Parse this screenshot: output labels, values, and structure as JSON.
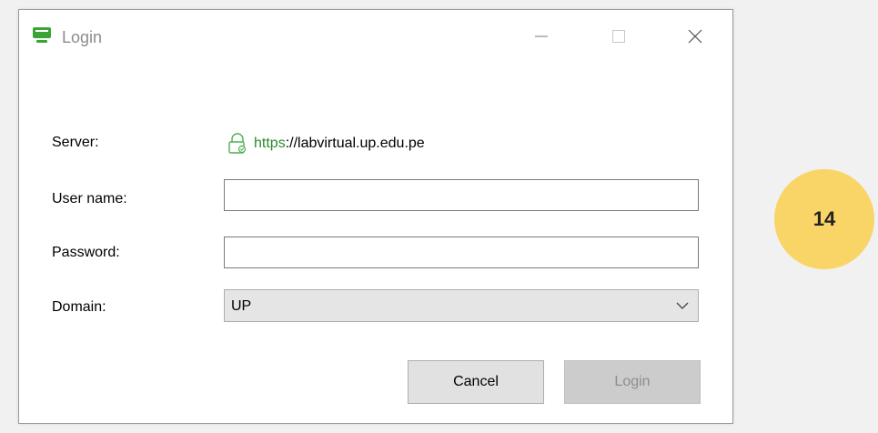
{
  "window": {
    "title": "Login"
  },
  "form": {
    "server_label": "Server:",
    "server_scheme": "https",
    "server_rest": "://labvirtual.up.edu.pe",
    "username_label": "User name:",
    "username_value": "",
    "password_label": "Password:",
    "password_value": "",
    "domain_label": "Domain:",
    "domain_value": "UP"
  },
  "buttons": {
    "cancel": "Cancel",
    "login": "Login"
  },
  "badge": {
    "number": "14"
  },
  "icons": {
    "app": "monitor-icon",
    "server": "lock-icon",
    "minimize": "minimize-icon",
    "maximize": "maximize-icon",
    "close": "close-icon",
    "dropdown": "chevron-down-icon"
  },
  "colors": {
    "accent_green": "#3aa535",
    "https_green": "#2a8a2a",
    "badge_yellow": "#f9d466",
    "disabled_text": "#8d8d8d"
  }
}
